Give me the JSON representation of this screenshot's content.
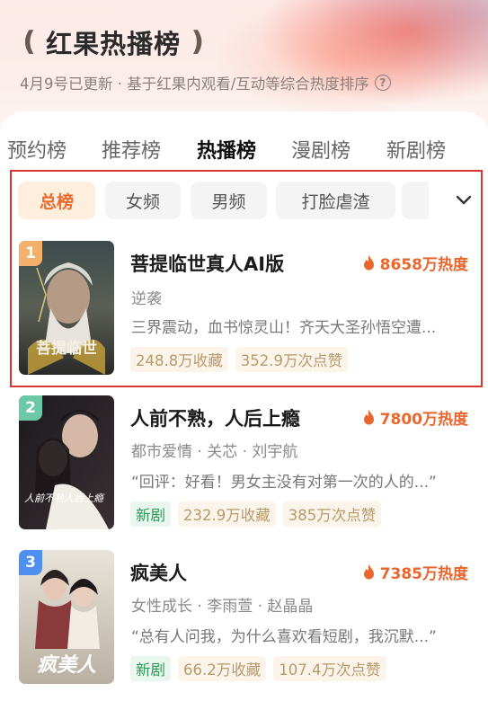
{
  "header": {
    "title": "红果热播榜",
    "subtitle": "4月9号已更新 · 基于红果内观看/互动等综合热度排序",
    "laurel_left": "❪",
    "laurel_right": "❫"
  },
  "tabs": [
    {
      "label": "预约榜",
      "active": false
    },
    {
      "label": "推荐榜",
      "active": false
    },
    {
      "label": "热播榜",
      "active": true
    },
    {
      "label": "漫剧榜",
      "active": false
    },
    {
      "label": "新剧榜",
      "active": false
    }
  ],
  "filters": [
    {
      "label": "总榜",
      "active": true
    },
    {
      "label": "女频",
      "active": false
    },
    {
      "label": "男频",
      "active": false
    },
    {
      "label": "打脸虐渣",
      "active": false
    }
  ],
  "items": [
    {
      "rank": "1",
      "title": "菩提临世真人AI版",
      "heat": "8658万热度",
      "genre": "逆袭",
      "desc": "三界震动，血书惊灵山！齐天大圣孙悟空遭...",
      "badges": [
        "248.8万收藏",
        "352.9万次点赞"
      ],
      "rank_color": "#f2b06b",
      "poster_text": "菩提临世"
    },
    {
      "rank": "2",
      "title": "人前不熟，人后上瘾",
      "heat": "7800万热度",
      "genre": "都市爱情 · 关芯 · 刘宇航",
      "desc": "“回评：好看！男女主没有对第一次的人的...”",
      "new_badge": "新剧",
      "badges": [
        "232.9万收藏",
        "385万次点赞"
      ],
      "rank_color": "#6cc9a8",
      "poster_text": "人前不熟人后上瘾"
    },
    {
      "rank": "3",
      "title": "疯美人",
      "heat": "7385万热度",
      "genre": "女性成长 · 李雨萱 · 赵晶晶",
      "desc": "“总有人问我，为什么喜欢看短剧，我沉默...”",
      "new_badge": "新剧",
      "badges": [
        "66.2万收藏",
        "107.4万次点赞"
      ],
      "rank_color": "#4e8ff0",
      "poster_text": "疯美人"
    }
  ],
  "colors": {
    "accent": "#e8672f",
    "highlight_border": "#d8352f",
    "new_green": "#2e9a57"
  }
}
